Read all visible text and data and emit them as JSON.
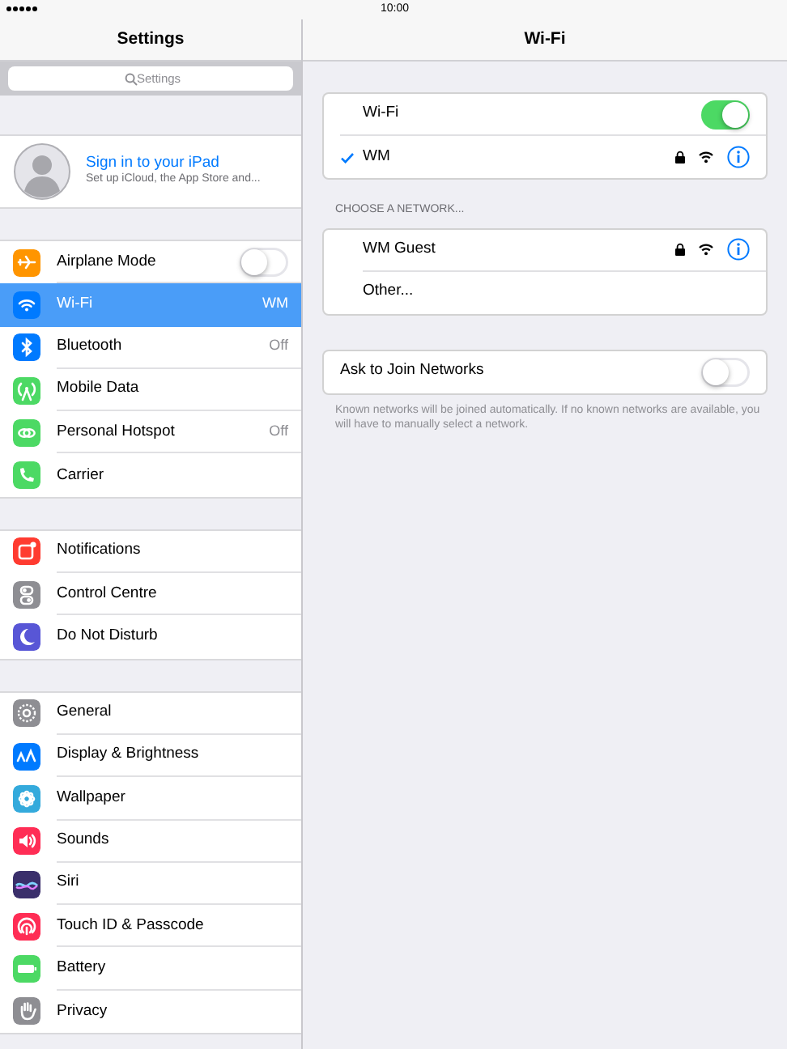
{
  "status_bar": {
    "time": "10:00"
  },
  "sidebar": {
    "title": "Settings",
    "search": {
      "placeholder": "Settings"
    },
    "account": {
      "title": "Sign in to your iPad",
      "subtitle": "Set up iCloud, the App Store and..."
    },
    "groups": [
      [
        {
          "label": "Airplane Mode",
          "kind": "toggle",
          "on": false,
          "selected": false,
          "color": "#ff9500"
        },
        {
          "label": "Wi-Fi",
          "kind": "link",
          "value": "WM",
          "selected": true,
          "color": "#007aff"
        },
        {
          "label": "Bluetooth",
          "kind": "link",
          "value": "Off",
          "selected": false,
          "color": "#007aff"
        },
        {
          "label": "Mobile Data",
          "kind": "link",
          "selected": false,
          "color": "#4cd964"
        },
        {
          "label": "Personal Hotspot",
          "kind": "link",
          "value": "Off",
          "selected": false,
          "color": "#4cd964"
        },
        {
          "label": "Carrier",
          "kind": "link",
          "selected": false,
          "color": "#4cd964"
        }
      ],
      [
        {
          "label": "Notifications",
          "kind": "link",
          "selected": false,
          "color": "#ff3b30"
        },
        {
          "label": "Control Centre",
          "kind": "link",
          "selected": false,
          "color": "#8e8e93"
        },
        {
          "label": "Do Not Disturb",
          "kind": "link",
          "selected": false,
          "color": "#5856d6"
        }
      ],
      [
        {
          "label": "General",
          "kind": "link",
          "selected": false,
          "color": "#8e8e93"
        },
        {
          "label": "Display & Brightness",
          "kind": "link",
          "selected": false,
          "color": "#007aff"
        },
        {
          "label": "Wallpaper",
          "kind": "link",
          "selected": false,
          "color": "#34aadc"
        },
        {
          "label": "Sounds",
          "kind": "link",
          "selected": false,
          "color": "#ff2d55"
        },
        {
          "label": "Siri",
          "kind": "link",
          "selected": false,
          "color": "#3a2f6b"
        },
        {
          "label": "Touch ID & Passcode",
          "kind": "link",
          "selected": false,
          "color": "#ff2d55"
        },
        {
          "label": "Battery",
          "kind": "link",
          "selected": false,
          "color": "#4cd964"
        },
        {
          "label": "Privacy",
          "kind": "link",
          "selected": false,
          "color": "#8e8e93"
        }
      ]
    ]
  },
  "detail": {
    "title": "Wi-Fi",
    "wifi": {
      "label": "Wi-Fi",
      "on": true
    },
    "current": {
      "name": "WM",
      "checked": true,
      "secured": true
    },
    "section_header": "CHOOSE A NETWORK...",
    "networks": [
      {
        "name": "WM Guest",
        "kind": "network",
        "secured": true
      },
      {
        "name": "Other...",
        "kind": "other"
      }
    ],
    "ask_to_join": {
      "label": "Ask to Join Networks",
      "on": false
    },
    "footer": "Known networks will be joined automatically. If no known networks are available, you will have to manually select a network."
  }
}
